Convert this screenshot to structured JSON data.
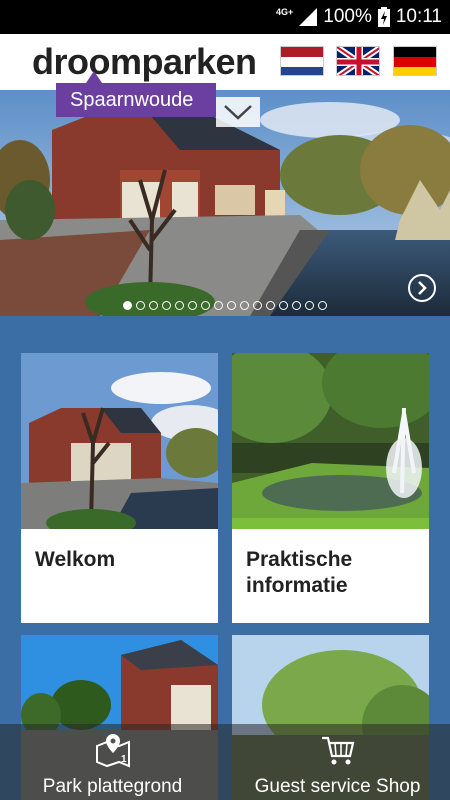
{
  "status_bar": {
    "network": "4G+",
    "battery": "100%",
    "time": "10:11"
  },
  "header": {
    "logo": "droomparken",
    "flags": [
      {
        "lang": "Nederlands",
        "icon": "flag-nl-icon"
      },
      {
        "lang": "English",
        "icon": "flag-uk-icon"
      },
      {
        "lang": "Deutsch",
        "icon": "flag-de-icon"
      }
    ]
  },
  "hero": {
    "location": "Spaarnwoude",
    "slide_count": 16,
    "active_slide": 1
  },
  "cards": [
    {
      "title": "Welkom"
    },
    {
      "title": "Praktische informatie"
    },
    {
      "title": ""
    },
    {
      "title": ""
    }
  ],
  "bottom_bar": {
    "items": [
      {
        "label": "Park plattegrond",
        "icon": "map-pin-icon"
      },
      {
        "label": "Guest service Shop",
        "icon": "cart-icon"
      }
    ]
  },
  "colors": {
    "brand_purple": "#6b3fa0",
    "background_blue": "#3a6ea5"
  }
}
